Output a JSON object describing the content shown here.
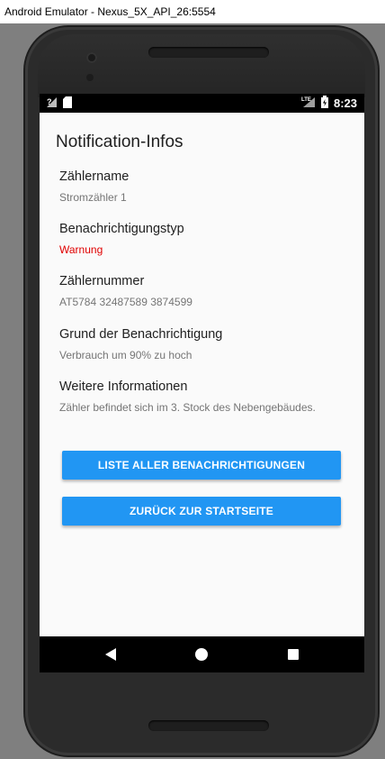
{
  "window": {
    "title": "Android Emulator - Nexus_5X_API_26:5554"
  },
  "status_bar": {
    "time": "8:23",
    "network": "LTE",
    "signal_icon": "signal-icon",
    "sim_icon": "sim-card-icon",
    "battery_icon": "battery-charging-icon"
  },
  "page": {
    "title": "Notification-Infos",
    "fields": [
      {
        "label": "Zählername",
        "value": "Stromzähler 1"
      },
      {
        "label": "Benachrichtigungstyp",
        "value": "Warnung",
        "value_color": "#e00000"
      },
      {
        "label": "Zählernummer",
        "value": "AT5784 32487589 3874599"
      },
      {
        "label": "Grund der Benachrichtigung",
        "value": "Verbrauch um 90% zu hoch"
      },
      {
        "label": "Weitere Informationen",
        "value": "Zähler befindet sich im 3. Stock des Nebengebäudes."
      }
    ],
    "buttons": {
      "list_all": "LISTE ALLER BENACHRICHTIGUNGEN",
      "back_home": "ZURÜCK ZUR STARTSEITE"
    }
  },
  "colors": {
    "accent": "#2196f3",
    "warning": "#e00000"
  },
  "nav_bar": {
    "back_icon": "back-triangle-icon",
    "home_icon": "home-circle-icon",
    "recents_icon": "recents-square-icon"
  }
}
